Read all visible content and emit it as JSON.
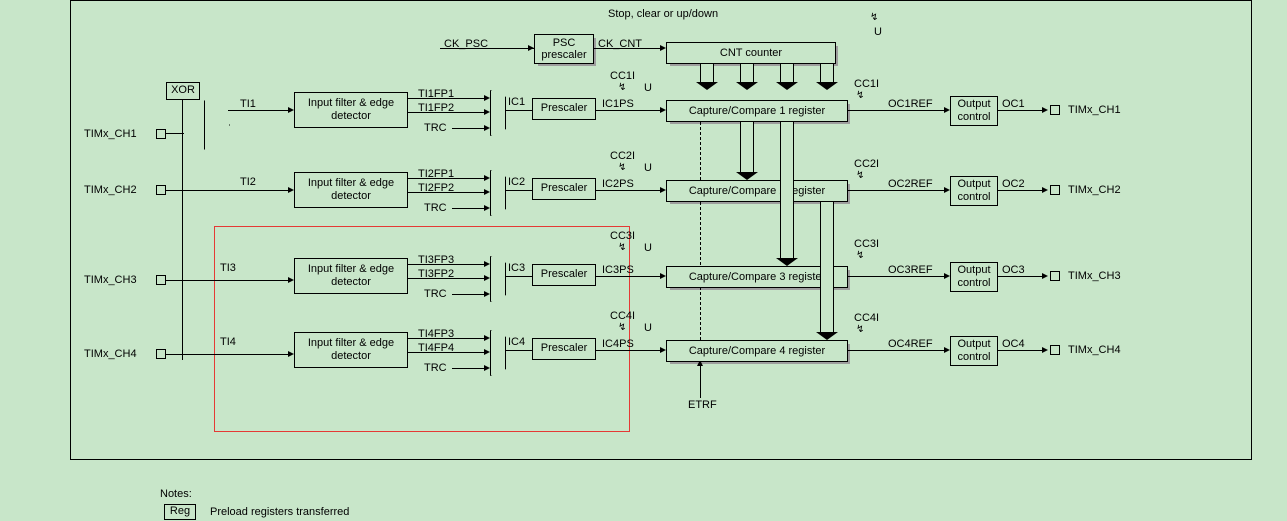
{
  "top": {
    "stopclear": "Stop, clear or up/down",
    "ck_psc": "CK_PSC",
    "psc_box": "PSC prescaler",
    "ck_cnt": "CK_CNT",
    "plusminus": "+/-",
    "cnt_counter": "CNT counter",
    "u": "U"
  },
  "xor": "XOR",
  "left_pins": [
    "TIMx_CH1",
    "TIMx_CH2",
    "TIMx_CH3",
    "TIMx_CH4"
  ],
  "right_pins": [
    "TIMx_CH1",
    "TIMx_CH2",
    "TIMx_CH3",
    "TIMx_CH4"
  ],
  "ti": [
    "TI1",
    "TI2",
    "TI3",
    "TI4"
  ],
  "filter": "Input filter & edge detector",
  "fp": {
    "ch1": [
      "TI1FP1",
      "TI1FP2"
    ],
    "ch2": [
      "TI2FP1",
      "TI2FP2"
    ],
    "ch3": [
      "TI3FP3",
      "TI3FP2"
    ],
    "ch4": [
      "TI4FP3",
      "TI4FP4"
    ]
  },
  "trc": "TRC",
  "ic": [
    "IC1",
    "IC2",
    "IC3",
    "IC4"
  ],
  "prescaler": "Prescaler",
  "icps": [
    "IC1PS",
    "IC2PS",
    "IC3PS",
    "IC4PS"
  ],
  "ccreg": [
    "Capture/Compare 1 register",
    "Capture/Compare 2 register",
    "Capture/Compare 3 register",
    "Capture/Compare 4 register"
  ],
  "cci_left": [
    "CC1I",
    "CC2I",
    "CC3I",
    "CC4I"
  ],
  "cci_right": [
    "CC1I",
    "CC2I",
    "CC3I",
    "CC4I"
  ],
  "u_small": "U",
  "ocref": [
    "OC1REF",
    "OC2REF",
    "OC3REF",
    "OC4REF"
  ],
  "output_control": "Output control",
  "oc": [
    "OC1",
    "OC2",
    "OC3",
    "OC4"
  ],
  "etrf": "ETRF",
  "notes": "Notes:",
  "reg": "Reg",
  "preload": "Preload registers transferred"
}
